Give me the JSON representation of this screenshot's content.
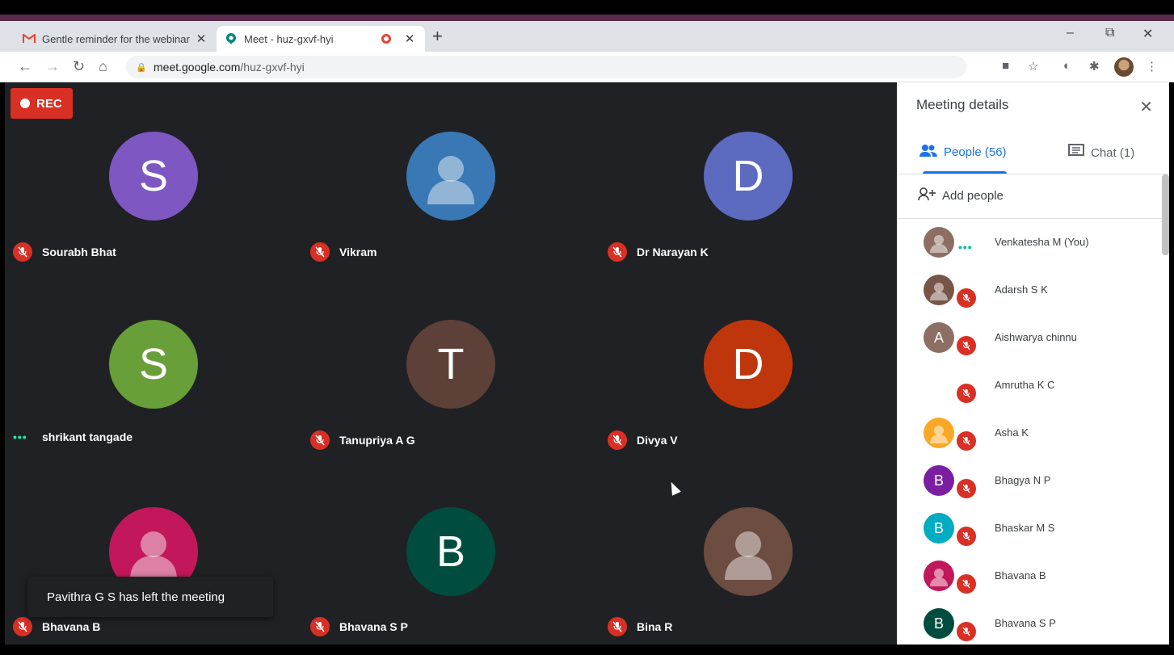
{
  "browser": {
    "tabs": [
      {
        "title": "Gentle reminder for the webinar",
        "icon": "gmail-icon",
        "close": "✕"
      },
      {
        "title": "Meet - huz-gxvf-hyi",
        "icon": "meet-icon",
        "close": "✕"
      }
    ],
    "new_tab": "+",
    "window_controls": {
      "minimize": "–",
      "restore": "⧉",
      "close": "✕"
    },
    "url": {
      "host": "meet.google.com",
      "path": "/huz-gxvf-hyi"
    }
  },
  "meeting": {
    "rec_label": "REC",
    "tiles": [
      {
        "name": "Sourabh Bhat",
        "initial": "S",
        "color": "#7e57c2",
        "state": "muted"
      },
      {
        "name": "Vikram",
        "initial": "",
        "color": "#3a78b5",
        "state": "muted"
      },
      {
        "name": "Dr Narayan K",
        "initial": "D",
        "color": "#5c6bc0",
        "state": "muted"
      },
      {
        "name": "shrikant tangade",
        "initial": "S",
        "color": "#689f38",
        "state": "talking"
      },
      {
        "name": "Tanupriya A G",
        "initial": "T",
        "color": "#5d4037",
        "state": "muted"
      },
      {
        "name": "Divya V",
        "initial": "D",
        "color": "#bf360c",
        "state": "muted"
      },
      {
        "name": "Bhavana B",
        "initial": "",
        "color": "#c2185b",
        "state": "muted"
      },
      {
        "name": "Bhavana S P",
        "initial": "B",
        "color": "#004d40",
        "state": "muted"
      },
      {
        "name": "Bina R",
        "initial": "",
        "color": "#6d4c41",
        "state": "muted"
      }
    ],
    "toast": "Pavithra G S has left the meeting"
  },
  "panel": {
    "title": "Meeting details",
    "tabs": {
      "people": "People (56)",
      "chat": "Chat (1)"
    },
    "add_people": "Add people",
    "people": [
      {
        "name": "Venkatesha M (You)",
        "initial": "",
        "color": "#8d6e63",
        "state": "talking"
      },
      {
        "name": "Adarsh S K",
        "initial": "",
        "color": "#795548",
        "state": "muted"
      },
      {
        "name": "Aishwarya chinnu",
        "initial": "A",
        "color": "#8d6e63",
        "state": "muted"
      },
      {
        "name": "Amrutha K C",
        "initial": "",
        "color": "#ffffff",
        "state": "muted"
      },
      {
        "name": "Asha K",
        "initial": "",
        "color": "#f9a825",
        "state": "muted"
      },
      {
        "name": "Bhagya N P",
        "initial": "B",
        "color": "#7b1fa2",
        "state": "muted"
      },
      {
        "name": "Bhaskar M S",
        "initial": "B",
        "color": "#00acc1",
        "state": "muted"
      },
      {
        "name": "Bhavana B",
        "initial": "",
        "color": "#c2185b",
        "state": "muted"
      },
      {
        "name": "Bhavana S P",
        "initial": "B",
        "color": "#004d40",
        "state": "muted"
      }
    ]
  }
}
